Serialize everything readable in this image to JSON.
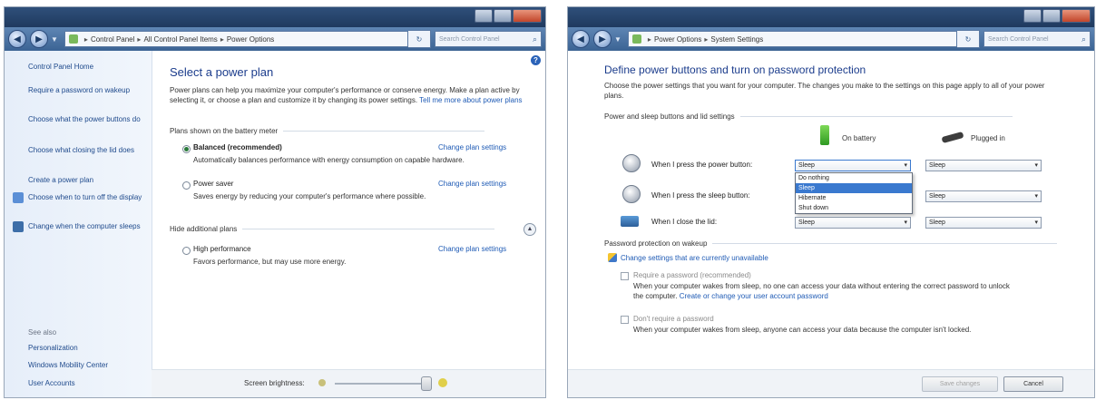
{
  "window1": {
    "address": {
      "segments": [
        "Control Panel",
        "All Control Panel Items",
        "Power Options"
      ],
      "search_placeholder": "Search Control Panel"
    },
    "sidebar": {
      "home": "Control Panel Home",
      "items": [
        "Require a password on wakeup",
        "Choose what the power buttons do",
        "Choose what closing the lid does",
        "Create a power plan",
        "Choose when to turn off the display",
        "Change when the computer sleeps"
      ],
      "see_also_heading": "See also",
      "see_also": [
        "Personalization",
        "Windows Mobility Center",
        "User Accounts"
      ]
    },
    "main": {
      "title": "Select a power plan",
      "intro": "Power plans can help you maximize your computer's performance or conserve energy. Make a plan active by selecting it, or choose a plan and customize it by changing its power settings.",
      "intro_link": "Tell me more about power plans",
      "section_battery": "Plans shown on the battery meter",
      "plans": [
        {
          "name": "Balanced (recommended)",
          "desc": "Automatically balances performance with energy consumption on capable hardware.",
          "link": "Change plan settings",
          "selected": true
        },
        {
          "name": "Power saver",
          "desc": "Saves energy by reducing your computer's performance where possible.",
          "link": "Change plan settings",
          "selected": false
        }
      ],
      "section_hidden": "Hide additional plans",
      "hidden_plans": [
        {
          "name": "High performance",
          "desc": "Favors performance, but may use more energy.",
          "link": "Change plan settings",
          "selected": false
        }
      ],
      "brightness_label": "Screen brightness:"
    }
  },
  "window2": {
    "address": {
      "segments": [
        "Power Options",
        "System Settings"
      ],
      "search_placeholder": "Search Control Panel"
    },
    "title": "Define power buttons and turn on password protection",
    "intro": "Choose the power settings that you want for your computer. The changes you make to the settings on this page apply to all of your power plans.",
    "section_buttons": "Power and sleep buttons and lid settings",
    "col_battery": "On battery",
    "col_plugged": "Plugged in",
    "rows": [
      {
        "label": "When I press the power button:",
        "battery": "Sleep",
        "plugged": "Sleep"
      },
      {
        "label": "When I press the sleep button:",
        "battery": "Sleep",
        "plugged": "Sleep"
      },
      {
        "label": "When I close the lid:",
        "battery": "Sleep",
        "plugged": "Sleep"
      }
    ],
    "dropdown_options": [
      "Do nothing",
      "Sleep",
      "Hibernate",
      "Shut down"
    ],
    "dropdown_selected": "Sleep",
    "section_password": "Password protection on wakeup",
    "unavailable_link": "Change settings that are currently unavailable",
    "require_label": "Require a password (recommended)",
    "require_desc": "When your computer wakes from sleep, no one can access your data without entering the correct password to unlock the computer.",
    "require_link": "Create or change your user account password",
    "norequire_label": "Don't require a password",
    "norequire_desc": "When your computer wakes from sleep, anyone can access your data because the computer isn't locked.",
    "save_label": "Save changes",
    "cancel_label": "Cancel"
  },
  "colors": {
    "link": "#1f5bb5",
    "heading": "#1b3c8c",
    "titlebar": "#2f4f7a",
    "highlight": "#3a79cf"
  }
}
